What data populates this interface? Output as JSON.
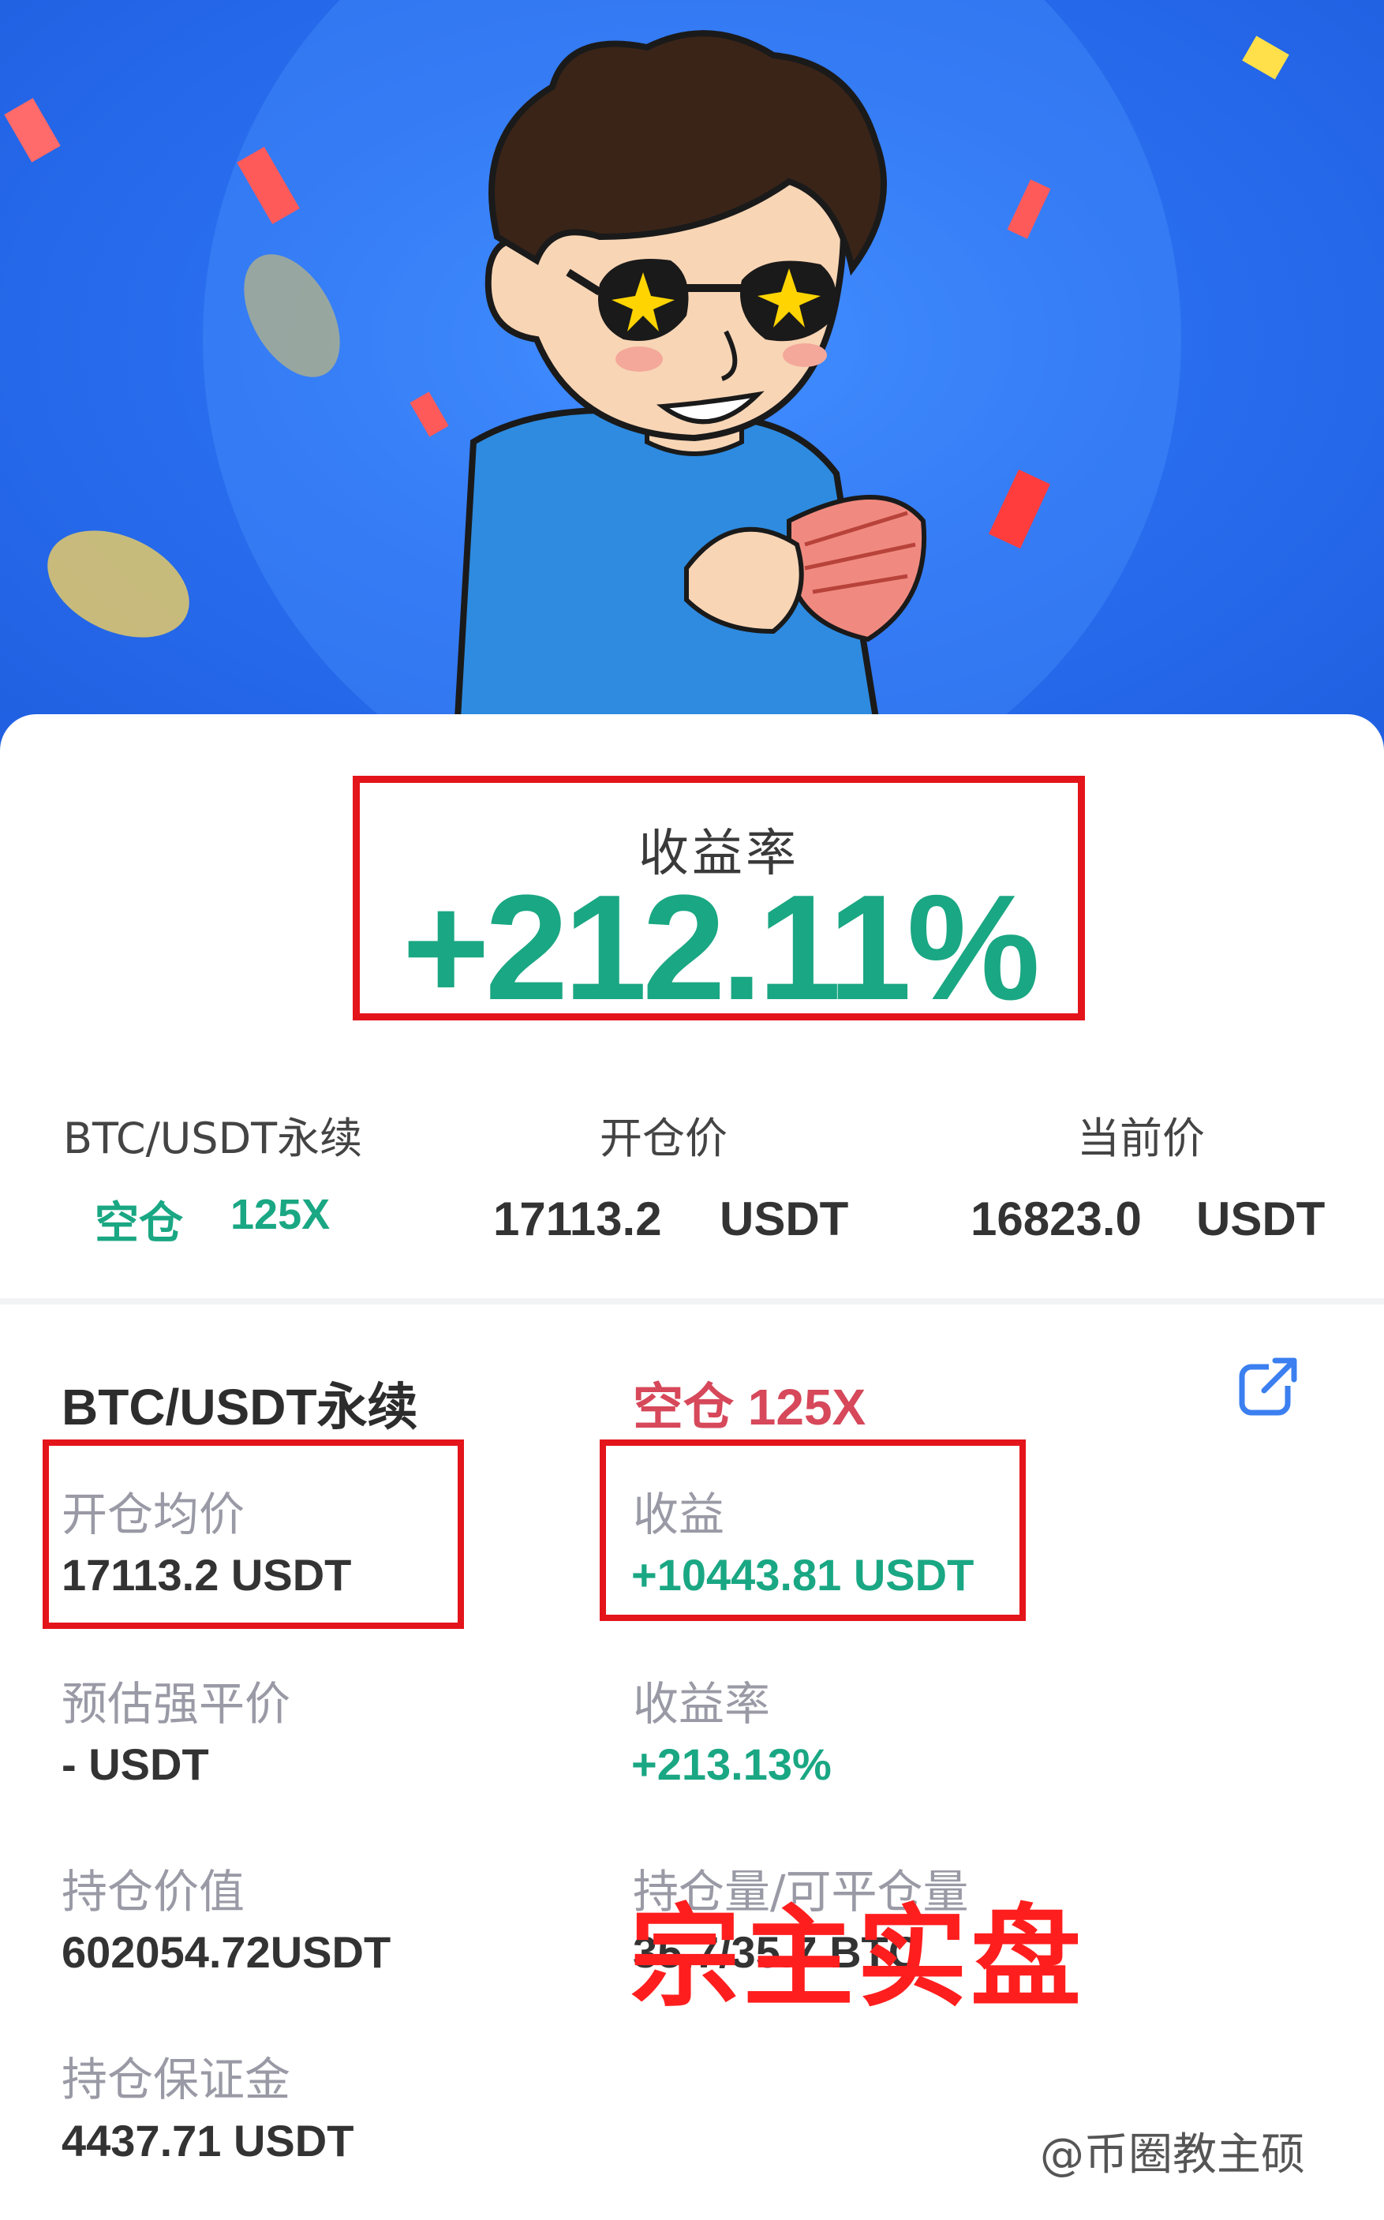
{
  "hero": {
    "illustration": "celebrating-cartoon-man-holding-cash"
  },
  "summary": {
    "rate_label": "收益率",
    "rate_value": "+212.11%",
    "pair": "BTC/USDT永续",
    "side": "空仓",
    "leverage": "125X",
    "open_label": "开仓价",
    "open_value": "17113.2",
    "open_unit": "USDT",
    "current_label": "当前价",
    "current_value": "16823.0",
    "current_unit": "USDT"
  },
  "detail": {
    "pair": "BTC/USDT永续",
    "side_leverage": "空仓 125X",
    "avg_open_label": "开仓均价",
    "avg_open_value": "17113.2 USDT",
    "pnl_label": "收益",
    "pnl_value": "+10443.81 USDT",
    "liq_label": "预估强平价",
    "liq_value": "-  USDT",
    "roe_label": "收益率",
    "roe_value": "+213.13%",
    "position_value_label": "持仓价值",
    "position_value": "602054.72USDT",
    "size_label": "持仓量/可平仓量",
    "size_value": "35.7/35.7 BTC",
    "margin_label": "持仓保证金",
    "margin_value": "4437.71 USDT",
    "share_icon": "share-external-icon"
  },
  "overlays": {
    "red_stamp": "宗主实盘",
    "source_watermark": "@币圈教主硕"
  },
  "colors": {
    "green": "#1aa783",
    "short_red": "#d6485a",
    "highlight_red": "#e4141b",
    "hero_blue": "#2a6ff0"
  }
}
